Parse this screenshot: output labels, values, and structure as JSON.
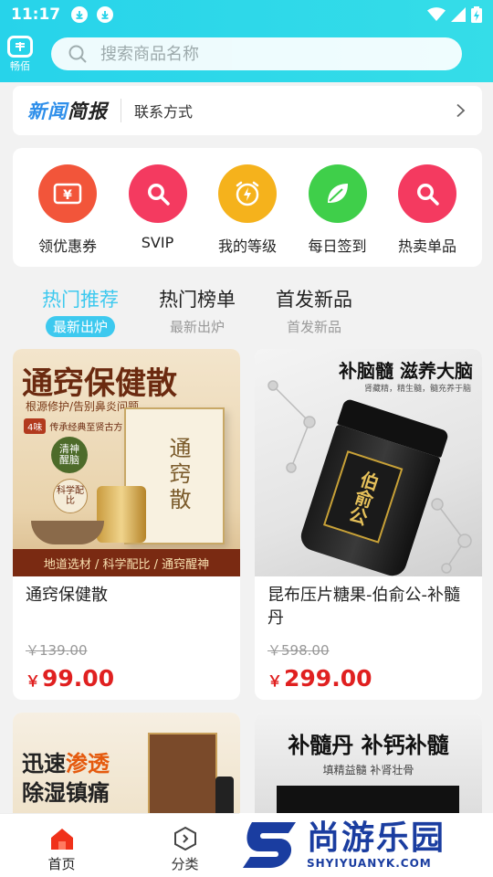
{
  "status_bar": {
    "time": "11:17"
  },
  "header": {
    "logo_text": "畅佰",
    "search_placeholder": "搜索商品名称"
  },
  "news": {
    "logo_part1": "新闻",
    "logo_part2": "简报",
    "contact_label": "联系方式"
  },
  "quick_actions": [
    {
      "label": "领优惠券",
      "icon": "coupon-icon",
      "color": "#f2553a"
    },
    {
      "label": "SVIP",
      "icon": "search-icon",
      "color": "#f43a60"
    },
    {
      "label": "我的等级",
      "icon": "alarm-bolt-icon",
      "color": "#f5b21c"
    },
    {
      "label": "每日签到",
      "icon": "leaf-icon",
      "color": "#3fcf4a"
    },
    {
      "label": "热卖单品",
      "icon": "search-icon",
      "color": "#f43a60"
    }
  ],
  "tabs": [
    {
      "title": "热门推荐",
      "subtitle": "最新出炉",
      "active": true
    },
    {
      "title": "热门榜单",
      "subtitle": "最新出炉",
      "active": false
    },
    {
      "title": "首发新品",
      "subtitle": "首发新品",
      "active": false
    }
  ],
  "products": [
    {
      "name": "通窍保健散",
      "original_price": "￥139.00",
      "currency": "￥",
      "price": "99.00",
      "image": {
        "headline": "通窍保健散",
        "sub": "根源修护/告别鼻炎问题",
        "tag": "传承经典至贤古方",
        "tag_num": "4味",
        "badge1": "清神醒脑",
        "badge2": "科学配比",
        "box_text": "通窍散",
        "footer": "地道选材 / 科学配比 / 通窍醒神"
      }
    },
    {
      "name": "昆布压片糖果-伯俞公-补髓丹",
      "original_price": "￥598.00",
      "currency": "￥",
      "price": "299.00",
      "image": {
        "headline": "补脑髓 滋养大脑",
        "sub": "肾藏精，精生髓，髓充养于脑",
        "jar_text": "伯俞公"
      }
    },
    {
      "name": "",
      "image": {
        "headline1": "迅速",
        "headline_hl": "渗透",
        "headline2": "除湿镇痛"
      }
    },
    {
      "name": "",
      "image": {
        "headline": "补髓丹 补钙补髓",
        "sub": "填精益髓 补肾壮骨"
      }
    }
  ],
  "bottom_nav": [
    {
      "label": "首页",
      "icon": "home-icon",
      "active": true
    },
    {
      "label": "分类",
      "icon": "category-icon",
      "active": false
    }
  ],
  "watermark": {
    "cn": "尚游乐园",
    "en": "SHYIYUANYK.COM"
  },
  "colors": {
    "accent": "#3dc9ef",
    "price": "#e02020",
    "header": "#27d3ea"
  }
}
